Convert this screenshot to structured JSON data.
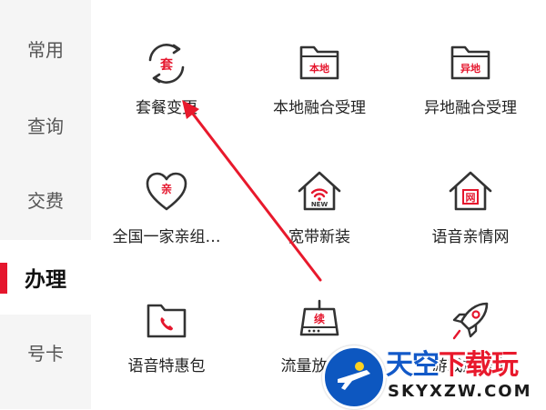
{
  "sidebar": {
    "items": [
      {
        "label": "常用",
        "active": false
      },
      {
        "label": "查询",
        "active": false
      },
      {
        "label": "交费",
        "active": false
      },
      {
        "label": "办理",
        "active": true
      },
      {
        "label": "号卡",
        "active": false
      }
    ]
  },
  "grid": {
    "tiles": [
      {
        "label": "套餐变更",
        "icon": "package-change-icon",
        "badge": "套"
      },
      {
        "label": "本地融合受理",
        "icon": "folder-local-icon",
        "badge": "本地"
      },
      {
        "label": "异地融合受理",
        "icon": "folder-remote-icon",
        "badge": "异地"
      },
      {
        "label": "全国一家亲组…",
        "icon": "heart-family-icon",
        "badge": "亲"
      },
      {
        "label": "宽带新装",
        "icon": "house-wifi-icon",
        "badge": "NEW"
      },
      {
        "label": "语音亲情网",
        "icon": "house-network-icon",
        "badge": "网"
      },
      {
        "label": "语音特惠包",
        "icon": "phone-folder-icon",
        "badge": ""
      },
      {
        "label": "流量放心用",
        "icon": "router-renew-icon",
        "badge": "续"
      },
      {
        "label": "游戏加速宝",
        "icon": "rocket-icon",
        "badge": ""
      }
    ]
  },
  "watermark": {
    "title_part1": "天空",
    "title_part2": "下载玩",
    "domain": "SKYXZW.COM"
  },
  "colors": {
    "accent": "#e5162d",
    "icon_stroke": "#333333",
    "arrow": "#e8192c",
    "sidebar_bg": "#f5f5f5"
  }
}
